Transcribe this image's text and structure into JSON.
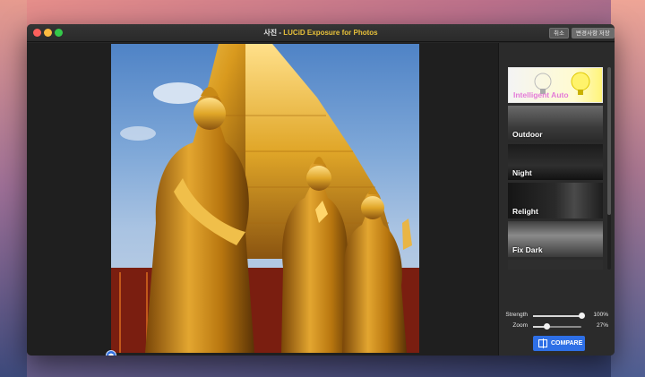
{
  "window": {
    "title_prefix": "사진 - ",
    "title_app": "LUCiD Exposure for Photos",
    "cancel_label": "취소",
    "save_label": "변경사항 저장"
  },
  "presets": [
    {
      "label": "Intelligent Auto"
    },
    {
      "label": "Outdoor"
    },
    {
      "label": "Night"
    },
    {
      "label": "Relight"
    },
    {
      "label": "Fix Dark"
    }
  ],
  "sliders": {
    "strength": {
      "label": "Strength",
      "value_text": "100%",
      "value": 1.0
    },
    "zoom": {
      "label": "Zoom",
      "value_text": "27%",
      "value": 0.27
    }
  },
  "compare_label": "COMPARE",
  "help_label": "?",
  "colors": {
    "accent": "#2e6fe6",
    "title_app": "#e8c13a",
    "preset_intelligent_label": "#e47ad8"
  }
}
